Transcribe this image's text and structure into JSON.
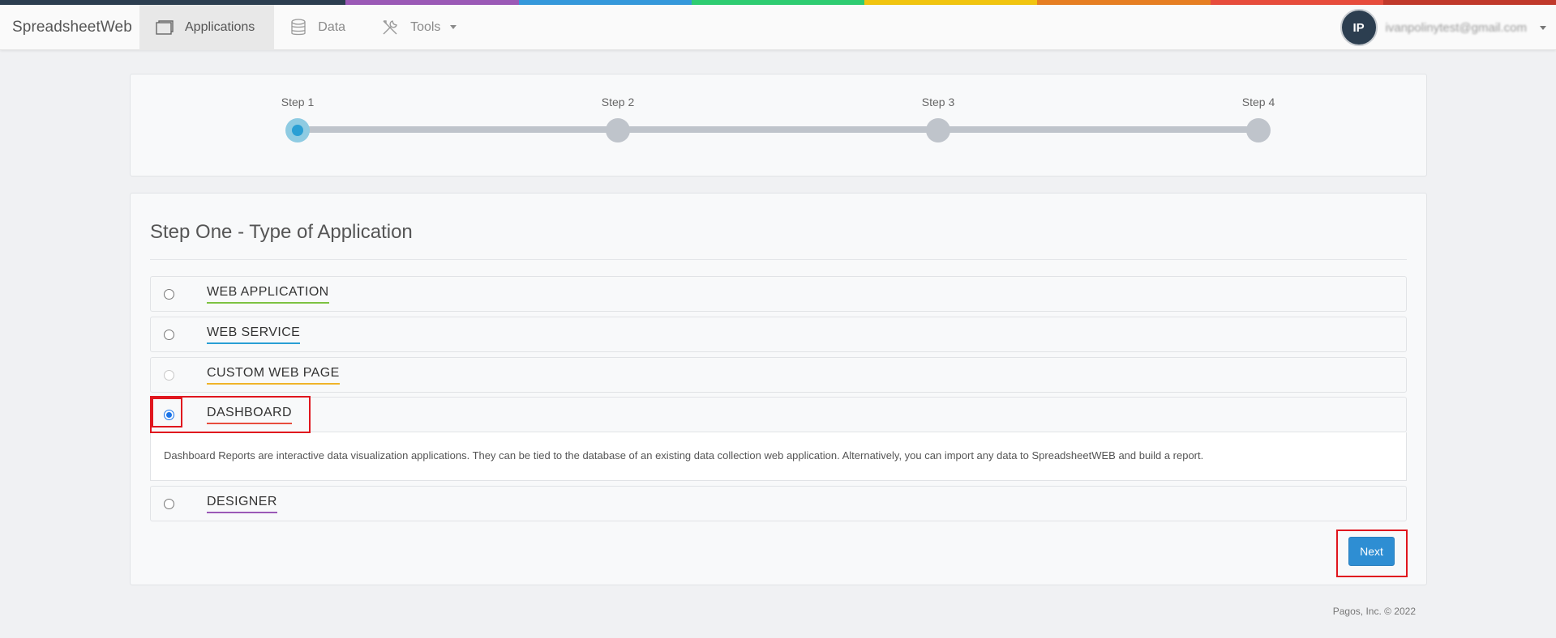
{
  "colors": {
    "stripe": [
      "#2c3e50",
      "#2c3e50",
      "#9b59b6",
      "#3498db",
      "#2ecc71",
      "#f1c40f",
      "#e67e22",
      "#e74c3c",
      "#c0392b"
    ],
    "accent": "#2e8ed3",
    "highlight": "#e0161e",
    "underlines": {
      "web_application": "#7dc242",
      "web_service": "#2a9fd4",
      "custom_web_page": "#f0b429",
      "dashboard": "#e74c3c",
      "designer": "#9b59b6"
    }
  },
  "navbar": {
    "brand": "SpreadsheetWeb",
    "items": [
      {
        "label": "Applications",
        "icon": "window-icon"
      },
      {
        "label": "Data",
        "icon": "database-icon"
      },
      {
        "label": "Tools",
        "icon": "tools-icon"
      }
    ],
    "user": {
      "initials": "IP",
      "email": "ivanpolinytest@gmail.com"
    }
  },
  "wizard": {
    "steps": [
      "Step 1",
      "Step 2",
      "Step 3",
      "Step 4"
    ],
    "active_step": 1
  },
  "main": {
    "title": "Step One - Type of Application",
    "options": [
      {
        "label": "WEB APPLICATION"
      },
      {
        "label": "WEB SERVICE"
      },
      {
        "label": "CUSTOM WEB PAGE"
      },
      {
        "label": "DASHBOARD"
      },
      {
        "label": "DESIGNER"
      }
    ],
    "selected": "DASHBOARD",
    "description": "Dashboard Reports are interactive data visualization applications. They can be tied to the database of an existing data collection web application. Alternatively, you can import any data to SpreadsheetWEB and build a report.",
    "next_label": "Next"
  },
  "footer": {
    "text": "Pagos, Inc. © 2022"
  }
}
